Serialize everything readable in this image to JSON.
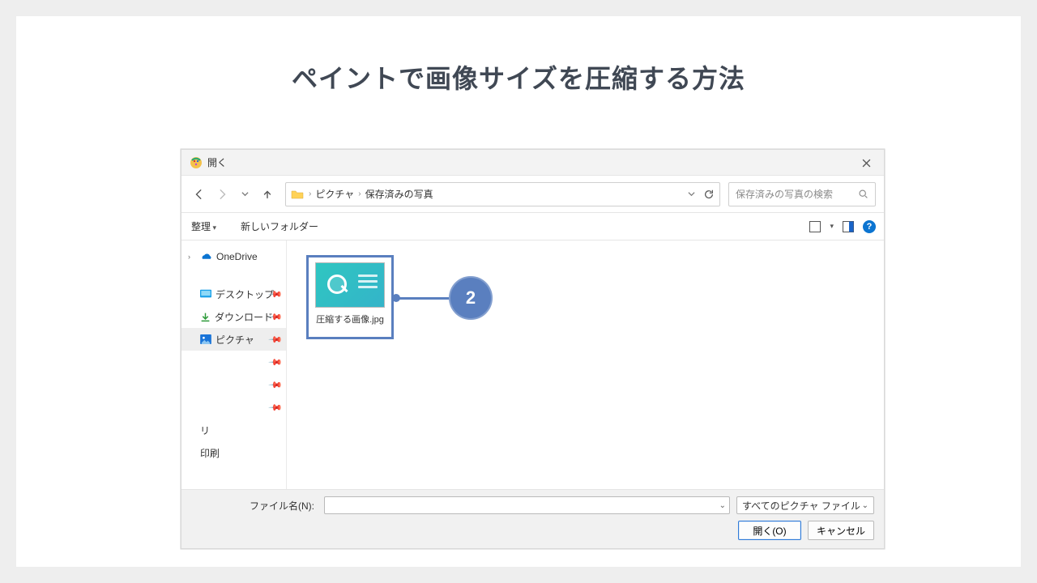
{
  "page": {
    "title": "ペイントで画像サイズを圧縮する方法"
  },
  "dialog": {
    "title": "開く",
    "breadcrumb": [
      "ピクチャ",
      "保存済みの写真"
    ],
    "search_placeholder": "保存済みの写真の検索",
    "organize": "整理",
    "new_folder": "新しいフォルダー"
  },
  "sidebar": {
    "onedrive": "OneDrive",
    "desktop": "デスクトップ",
    "downloads": "ダウンロード",
    "pictures": "ピクチャ",
    "extra1": "リ",
    "extra2": "印刷"
  },
  "file": {
    "thumb_label": "圧縮する画像.jpg",
    "callout_number": "2"
  },
  "footer": {
    "filename_label": "ファイル名(N):",
    "filetype": "すべてのピクチャ ファイル",
    "open": "開く(O)",
    "cancel": "キャンセル"
  }
}
